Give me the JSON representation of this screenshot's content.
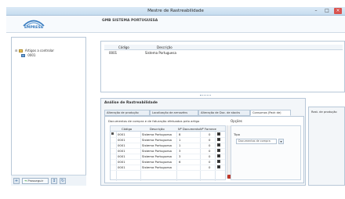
{
  "window": {
    "title": "Mestre de Rastreabilidade"
  },
  "header": {
    "logo_text": "EMPRESA",
    "company": "GMB SISTEMA PORTUGUESA"
  },
  "tree": {
    "root_label": "Artigos a controlar",
    "child_label": "0001"
  },
  "leftbar": {
    "add_label": "+",
    "forward_label": "Prosseguir",
    "btn2_label": "↕",
    "btn3_label": "↻"
  },
  "grid1": {
    "headers": {
      "code": "Código",
      "description": "Descrição"
    },
    "row": {
      "code": "0001",
      "description": "Sistema Portuguesa"
    }
  },
  "lower": {
    "title": "Análise de Rastreabilidade",
    "tabs": [
      "Alteração de produção",
      "Localização de armazéns",
      "Alteração de Doc. de stocks",
      "Consumos (Pack de)"
    ],
    "doc_heading": "Documentos de compra e de faturação efetuados pelo artigo",
    "options_heading": "Opções",
    "grid": {
      "headers": {
        "code": "Código",
        "description": "Descrição",
        "docno": "Nº Documento",
        "supplier": "Nº Fornece"
      },
      "rows": [
        {
          "code": "0001",
          "description": "Sistema Portuguesa",
          "docno": "8",
          "supplier": "0"
        },
        {
          "code": "0001",
          "description": "Sistema Portuguesa",
          "docno": "1",
          "supplier": "0"
        },
        {
          "code": "0001",
          "description": "Sistema Portuguesa",
          "docno": "1",
          "supplier": "0"
        },
        {
          "code": "0001",
          "description": "Sistema Portuguesa",
          "docno": "3",
          "supplier": "0"
        },
        {
          "code": "0001",
          "description": "Sistema Portuguesa",
          "docno": "3",
          "supplier": "0"
        },
        {
          "code": "0001",
          "description": "Sistema Portuguesa",
          "docno": "6",
          "supplier": "0"
        },
        {
          "code": "0001",
          "description": "Sistema Portuguesa",
          "docno": "",
          "supplier": "0"
        }
      ]
    },
    "options": {
      "type_label": "Tipo",
      "type_value": "Documentos de compra"
    }
  },
  "right_stub": {
    "tab_label": "Rast. de produção"
  },
  "colors": {
    "accent": "#3a7dc0",
    "titlebar": "#c6dcef"
  }
}
